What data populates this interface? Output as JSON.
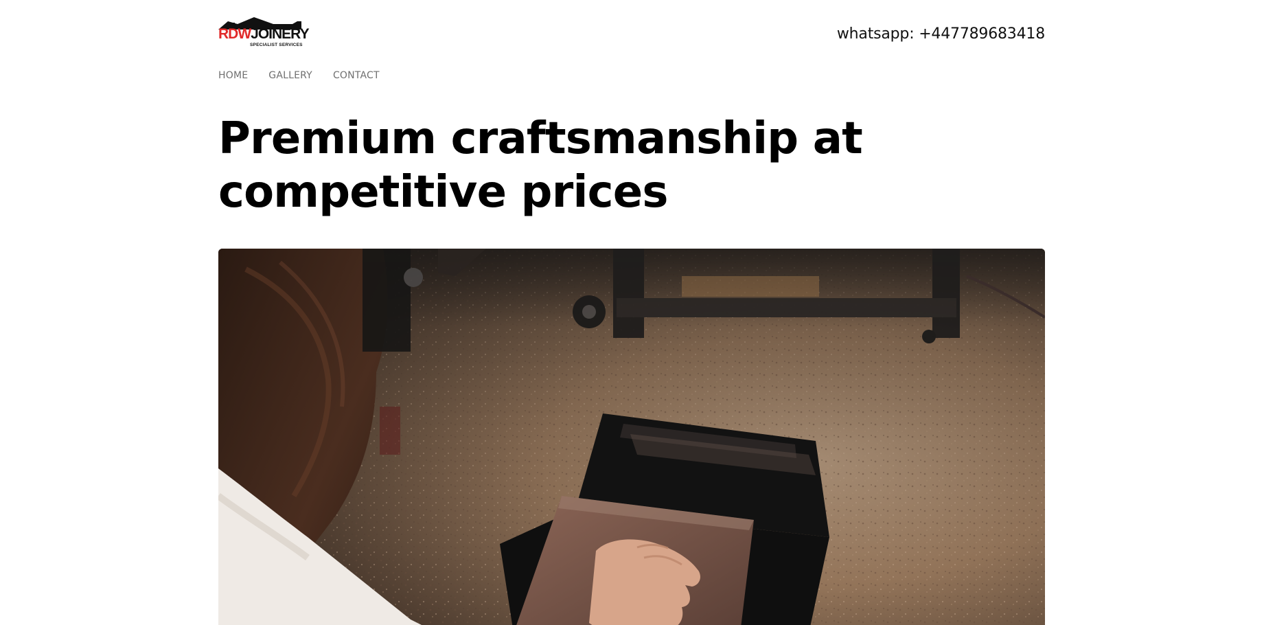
{
  "brand": {
    "logo_primary": "RDW",
    "logo_secondary": "JOINERY",
    "logo_subtitle": "SPECIALIST SERVICES",
    "accent_color": "#e12a2a"
  },
  "contact": {
    "whatsapp_text": "whatsapp: +447789683418"
  },
  "nav": {
    "items": [
      {
        "label": "HOME"
      },
      {
        "label": "GALLERY"
      },
      {
        "label": "CONTACT"
      }
    ]
  },
  "hero": {
    "title": "Premium craftsmanship at competitive prices",
    "image_icon": "woodworking-photo"
  }
}
